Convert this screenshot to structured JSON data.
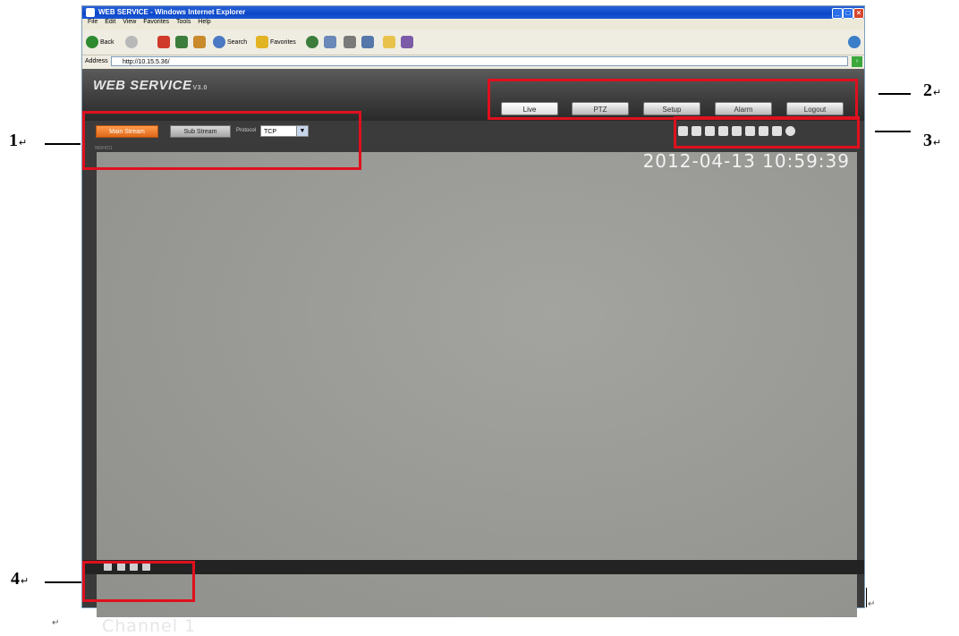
{
  "window": {
    "title": "WEB SERVICE - Windows Internet Explorer",
    "menu": [
      "File",
      "Edit",
      "View",
      "Favorites",
      "Tools",
      "Help"
    ],
    "toolbar": {
      "back": "Back",
      "search": "Search",
      "favorites": "Favorites"
    },
    "address_label": "Address",
    "address_value": "http://10.15.5.36/"
  },
  "app": {
    "logo": "WEB SERVICE",
    "logo_version": "V3.0",
    "nav_tabs": [
      "Live",
      "PTZ",
      "Setup",
      "Alarm",
      "Logout"
    ],
    "active_tab": "Live",
    "main_stream": "Main Stream",
    "sub_stream": "Sub Stream",
    "protocol_label": "Protocol",
    "protocol_value": "TCP",
    "resolution": "960H/D1",
    "timestamp": "2012-04-13 10:59:39",
    "channel": "Channel 1"
  },
  "annotations": {
    "one": "1",
    "two": "2",
    "three": "3",
    "four": "4",
    "return_mark": "↵"
  },
  "colors": {
    "main_stream_active": "#e0691b",
    "annotation_box": "#e0101e",
    "ie_titlebar": "#0a46c8"
  }
}
